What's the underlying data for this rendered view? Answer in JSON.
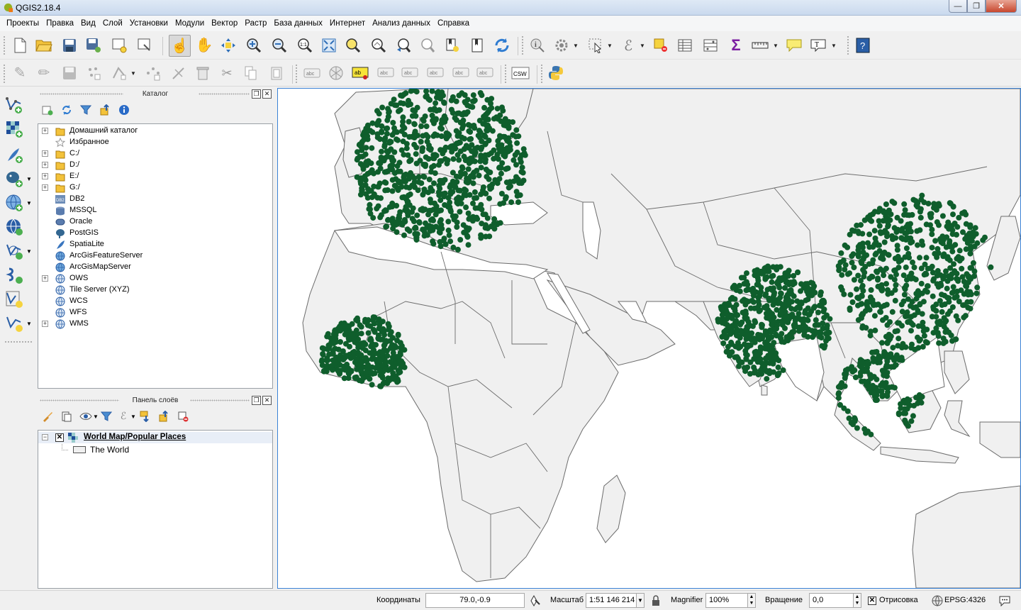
{
  "window": {
    "title": "QGIS2.18.4",
    "icon": "qgis-logo-icon",
    "buttons": {
      "minimize": "—",
      "maximize": "❐",
      "close": "✕"
    }
  },
  "menubar": {
    "items": [
      "Проекты",
      "Правка",
      "Вид",
      "Слой",
      "Установки",
      "Модули",
      "Вектор",
      "Растр",
      "База данных",
      "Интернет",
      "Анализ данных",
      "Справка"
    ]
  },
  "toolbar2": {
    "csw_label": "CSW",
    "abc_label": "abc"
  },
  "browser_panel": {
    "title": "Каталог",
    "items": [
      {
        "label": "Домашний каталог",
        "icon": "folder-icon",
        "expandable": true
      },
      {
        "label": "Избранное",
        "icon": "star-icon",
        "expandable": false
      },
      {
        "label": "C:/",
        "icon": "folder-icon",
        "expandable": true
      },
      {
        "label": "D:/",
        "icon": "folder-icon",
        "expandable": true
      },
      {
        "label": "E:/",
        "icon": "folder-icon",
        "expandable": true
      },
      {
        "label": "G:/",
        "icon": "folder-icon",
        "expandable": true
      },
      {
        "label": "DB2",
        "icon": "db2-icon",
        "expandable": false
      },
      {
        "label": "MSSQL",
        "icon": "mssql-icon",
        "expandable": false
      },
      {
        "label": "Oracle",
        "icon": "oracle-icon",
        "expandable": false
      },
      {
        "label": "PostGIS",
        "icon": "postgis-icon",
        "expandable": false
      },
      {
        "label": "SpatiaLite",
        "icon": "spatialite-icon",
        "expandable": false
      },
      {
        "label": "ArcGisFeatureServer",
        "icon": "arcgis-icon",
        "expandable": false
      },
      {
        "label": "ArcGisMapServer",
        "icon": "arcgis-icon",
        "expandable": false
      },
      {
        "label": "OWS",
        "icon": "globe-icon",
        "expandable": true
      },
      {
        "label": "Tile Server (XYZ)",
        "icon": "globe-icon",
        "expandable": false
      },
      {
        "label": "WCS",
        "icon": "globe-icon",
        "expandable": false
      },
      {
        "label": "WFS",
        "icon": "globe-icon",
        "expandable": false
      },
      {
        "label": "WMS",
        "icon": "globe-icon",
        "expandable": true
      }
    ]
  },
  "layers_panel": {
    "title": "Панель слоёв",
    "group": {
      "label": "World Map/Popular Places",
      "checked": "✕",
      "expander": "−"
    },
    "layers": [
      {
        "label": "The World"
      }
    ]
  },
  "map": {
    "ocean_color": "#ffffff",
    "land_color": "#f0f0f0",
    "border_color": "#6b6b6b",
    "point_color": "#0f5e2c"
  },
  "statusbar": {
    "coords_label": "Координаты",
    "coords_value": "79.0,-0.9",
    "scale_label": "Масштаб",
    "scale_value": "1:51 146 214",
    "magnifier_label": "Magnifier",
    "magnifier_value": "100%",
    "rotation_label": "Вращение",
    "rotation_value": "0,0",
    "render_label": "Отрисовка",
    "render_checked": "✕",
    "crs_label": "EPSG:4326"
  }
}
